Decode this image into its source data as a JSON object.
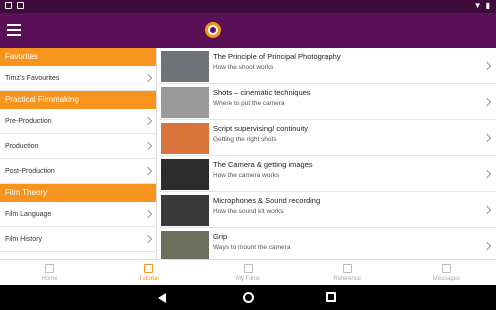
{
  "colors": {
    "appbar": "#5b0f56",
    "statusbar": "#3e0b3b",
    "accent": "#f7941d"
  },
  "sidebar": {
    "sections": [
      {
        "header": "Favorites",
        "items": [
          "Timz's Favourites"
        ]
      },
      {
        "header": "Practical Filmmaking",
        "items": [
          "Pre-Production",
          "Production",
          "Post-Production"
        ]
      },
      {
        "header": "Film Theory",
        "items": [
          "Film Language",
          "Film History"
        ]
      }
    ]
  },
  "list": [
    {
      "title": "The Principle of Principal Photography",
      "subtitle": "How the shoot works",
      "thumb_color": "#6e7377"
    },
    {
      "title": "Shots – cinematic techniques",
      "subtitle": "Where to put the camera",
      "thumb_color": "#9a9a9a"
    },
    {
      "title": "Script supervising/ continuity",
      "subtitle": "Getting the right shots",
      "thumb_color": "#d8733a"
    },
    {
      "title": "The Camera & getting images",
      "subtitle": "How the camera works",
      "thumb_color": "#2c2c2c"
    },
    {
      "title": "Microphones & Sound recording",
      "subtitle": "How the sound kit works",
      "thumb_color": "#3a3a3a"
    },
    {
      "title": "Grip",
      "subtitle": "Ways to mount the camera",
      "thumb_color": "#6b6f5c"
    }
  ],
  "bottom_nav": [
    {
      "label": "Home",
      "icon": "home-icon",
      "active": false
    },
    {
      "label": "Tutorial",
      "icon": "tutorial-icon",
      "active": true
    },
    {
      "label": "My Films",
      "icon": "film-icon",
      "active": false
    },
    {
      "label": "Reference",
      "icon": "reference-icon",
      "active": false
    },
    {
      "label": "Messages",
      "icon": "mail-icon",
      "active": false
    }
  ]
}
